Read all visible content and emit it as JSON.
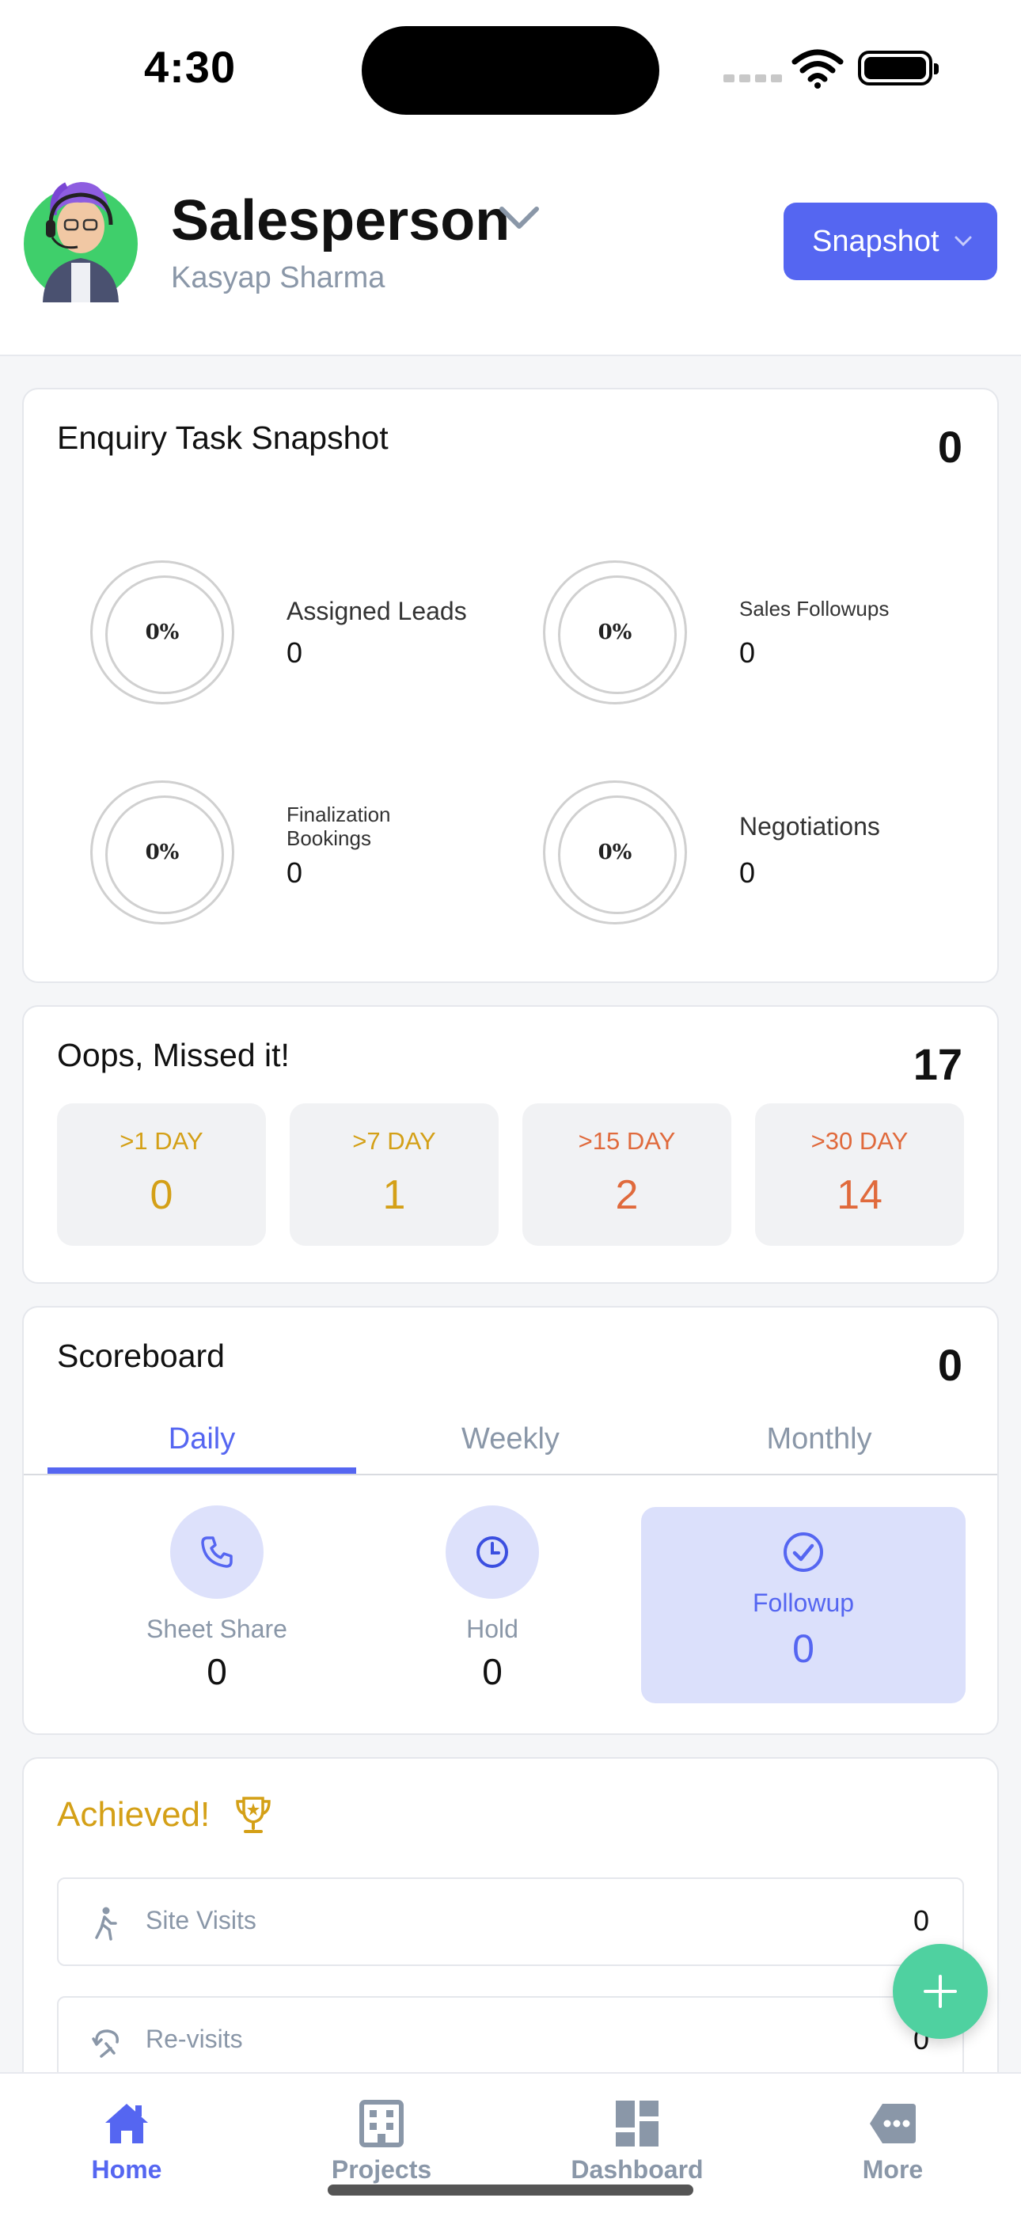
{
  "status_bar": {
    "time": "4:30"
  },
  "header": {
    "role": "Salesperson",
    "user_name": "Kasyap Sharma",
    "snapshot_button": "Snapshot"
  },
  "enquiry": {
    "title": "Enquiry Task Snapshot",
    "count": "0",
    "items": [
      {
        "percent": "0%",
        "label": "Assigned Leads",
        "value": "0"
      },
      {
        "percent": "0%",
        "label": "Sales Followups",
        "value": "0"
      },
      {
        "percent": "0%",
        "label": "Finalization Bookings",
        "value": "0"
      },
      {
        "percent": "0%",
        "label": "Negotiations",
        "value": "0"
      }
    ]
  },
  "missed": {
    "title": "Oops, Missed it!",
    "count": "17",
    "buckets": [
      {
        "label": ">1 DAY",
        "value": "0",
        "color": "#d4a017"
      },
      {
        "label": ">7 DAY",
        "value": "1",
        "color": "#d4a017"
      },
      {
        "label": ">15 DAY",
        "value": "2",
        "color": "#e06a3c"
      },
      {
        "label": ">30 DAY",
        "value": "14",
        "color": "#e06a3c"
      }
    ]
  },
  "scoreboard": {
    "title": "Scoreboard",
    "count": "0",
    "tabs": [
      "Daily",
      "Weekly",
      "Monthly"
    ],
    "active_tab": "Daily",
    "items": [
      {
        "label": "Sheet Share",
        "value": "0",
        "icon": "phone-icon"
      },
      {
        "label": "Hold",
        "value": "0",
        "icon": "clock-icon"
      },
      {
        "label": "Followup",
        "value": "0",
        "icon": "check-circle-icon"
      }
    ]
  },
  "achieved": {
    "title": "Achieved!",
    "rows": [
      {
        "label": "Site Visits",
        "value": "0",
        "icon": "walking-icon"
      },
      {
        "label": "Re-visits",
        "value": "0",
        "icon": "revisit-icon"
      }
    ]
  },
  "bottom_nav": {
    "items": [
      {
        "label": "Home",
        "icon": "home-icon",
        "active": true
      },
      {
        "label": "Projects",
        "icon": "building-icon",
        "active": false
      },
      {
        "label": "Dashboard",
        "icon": "dashboard-icon",
        "active": false
      },
      {
        "label": "More",
        "icon": "more-icon",
        "active": false
      }
    ]
  },
  "colors": {
    "accent": "#5566f1",
    "accent_light": "#dde1fb",
    "fab": "#4fd1a0",
    "achieved": "#d4a017",
    "muted": "#8a97a8"
  }
}
